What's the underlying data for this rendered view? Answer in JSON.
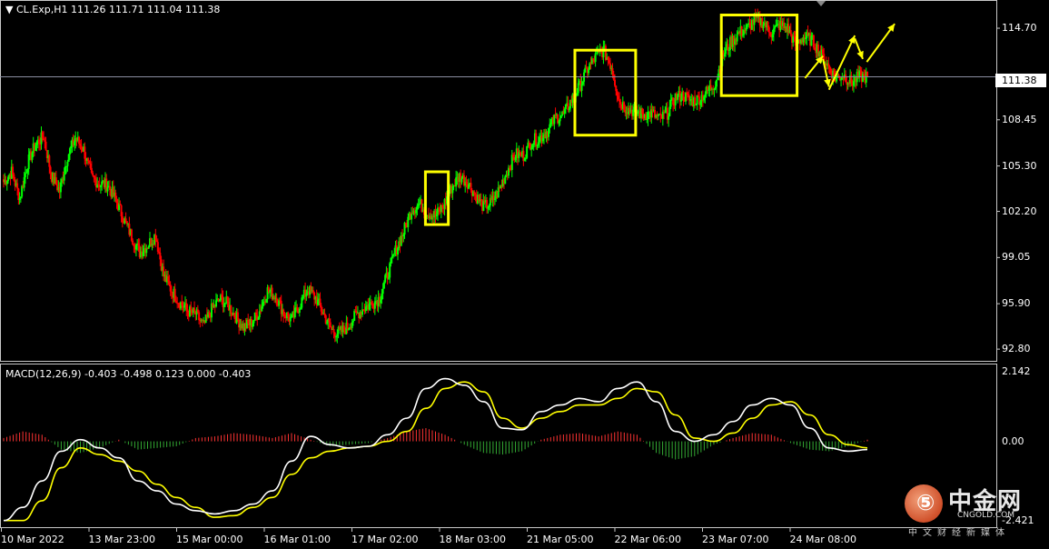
{
  "price_header": "CL.Exp,H1  111.26 111.71 111.04 111.38",
  "macd_header": "MACD(12,26,9) -0.403 -0.498 0.123 0.000 -0.403",
  "current_price": "111.38",
  "colors": {
    "background": "#000000",
    "bull_candle": "#00ff00",
    "bear_candle": "#ff0000",
    "macd_line": "#ffffff",
    "signal_line": "#ffff00",
    "hist_positive": "#ff3333",
    "hist_negative": "#33aa33",
    "annotation_box": "#ffff00",
    "current_price_line": "#8a8ea0"
  },
  "watermark": {
    "logo_glyph": "⑤",
    "text": "中金网",
    "sub": "CNGOLD.COM",
    "sub_cn": "中文财经新媒体"
  },
  "chart_data": [
    {
      "type": "candlestick",
      "title": "CL.Exp,H1",
      "y_ticks": [
        "114.70",
        "111.38",
        "108.45",
        "105.30",
        "102.20",
        "99.05",
        "95.90",
        "92.80"
      ],
      "x_ticks": [
        "10 Mar 2022",
        "13 Mar 23:00",
        "15 Mar 00:00",
        "16 Mar 01:00",
        "17 Mar 02:00",
        "18 Mar 03:00",
        "21 Mar 05:00",
        "22 Mar 06:00",
        "23 Mar 07:00",
        "24 Mar 08:00"
      ],
      "ylim": [
        92.0,
        116.5
      ],
      "close_path": [
        104.2,
        104.9,
        103.1,
        105.5,
        106.8,
        107.3,
        104.6,
        103.6,
        106.0,
        107.2,
        106.4,
        104.5,
        104.1,
        104.0,
        103.0,
        101.7,
        100.5,
        99.4,
        99.9,
        100.6,
        97.8,
        96.8,
        96.0,
        95.4,
        95.2,
        94.4,
        95.5,
        96.2,
        95.9,
        95.0,
        94.3,
        94.6,
        95.4,
        96.8,
        96.4,
        95.3,
        94.8,
        95.8,
        96.9,
        96.3,
        95.2,
        94.1,
        93.9,
        94.3,
        95.1,
        95.6,
        95.9,
        96.3,
        97.9,
        99.5,
        100.8,
        102.3,
        102.7,
        102.1,
        101.9,
        102.6,
        103.8,
        104.6,
        104.2,
        103.3,
        102.5,
        102.8,
        103.7,
        105.0,
        106.1,
        106.0,
        107.0,
        107.2,
        107.7,
        108.6,
        108.8,
        109.8,
        110.7,
        111.9,
        112.7,
        113.2,
        112.1,
        109.7,
        109.2,
        109.0,
        108.8,
        108.9,
        108.5,
        108.9,
        110.0,
        110.1,
        109.7,
        109.9,
        110.4,
        111.0,
        112.9,
        113.8,
        114.4,
        114.7,
        115.3,
        115.1,
        114.4,
        114.9,
        114.7,
        113.6,
        114.1,
        113.9,
        113.1,
        112.2,
        111.3,
        111.5,
        111.0,
        111.4,
        111.38
      ],
      "price_line": 111.38,
      "highlight_boxes": [
        {
          "t0": 0.427,
          "t1": 0.45,
          "low": 101.3,
          "high": 104.9
        },
        {
          "t0": 0.577,
          "t1": 0.638,
          "low": 107.4,
          "high": 113.2
        },
        {
          "t0": 0.724,
          "t1": 0.8,
          "low": 110.1,
          "high": 115.6
        }
      ],
      "forecast_arrows": [
        {
          "from": [
            0.808,
            111.3
          ],
          "to": [
            0.826,
            112.8
          ]
        },
        {
          "from": [
            0.826,
            112.6
          ],
          "to": [
            0.832,
            110.7
          ]
        },
        {
          "from": [
            0.832,
            110.5
          ],
          "to": [
            0.858,
            114.2
          ]
        },
        {
          "from": [
            0.858,
            114.0
          ],
          "to": [
            0.866,
            112.6
          ]
        },
        {
          "from": [
            0.87,
            112.4
          ],
          "to": [
            0.898,
            115.0
          ]
        }
      ]
    },
    {
      "type": "line",
      "title": "MACD(12,26,9)",
      "y_ticks": [
        "2.142",
        "0.00",
        "-2.421"
      ],
      "ylim": [
        -2.6,
        2.3
      ],
      "series": [
        {
          "name": "MACD",
          "values": [
            -2.4,
            -2.0,
            -1.2,
            -0.3,
            0.05,
            -0.2,
            -0.5,
            -1.2,
            -1.5,
            -1.9,
            -2.1,
            -2.2,
            -2.1,
            -1.9,
            -1.5,
            -0.6,
            0.15,
            -0.1,
            -0.2,
            -0.15,
            0.2,
            0.7,
            1.6,
            1.9,
            1.7,
            1.2,
            0.4,
            0.35,
            0.9,
            1.1,
            1.3,
            1.2,
            1.6,
            1.8,
            1.2,
            0.3,
            0.0,
            0.2,
            0.6,
            1.1,
            1.3,
            1.1,
            0.4,
            -0.2,
            -0.3,
            -0.25
          ]
        },
        {
          "name": "Signal",
          "values": [
            -2.4,
            -2.4,
            -1.8,
            -0.8,
            -0.2,
            -0.4,
            -0.6,
            -0.9,
            -1.3,
            -1.7,
            -2.0,
            -2.3,
            -2.25,
            -2.0,
            -1.7,
            -1.0,
            -0.5,
            -0.3,
            -0.2,
            -0.15,
            0.0,
            0.3,
            1.0,
            1.6,
            1.8,
            1.5,
            0.7,
            0.4,
            0.7,
            0.9,
            1.1,
            1.1,
            1.3,
            1.6,
            1.5,
            0.8,
            0.1,
            0.0,
            0.25,
            0.7,
            1.1,
            1.2,
            0.8,
            0.2,
            -0.1,
            -0.2
          ]
        },
        {
          "name": "Histogram",
          "values": [
            0.1,
            0.3,
            0.2,
            -0.25,
            -0.35,
            -0.2,
            0.05,
            -0.25,
            -0.2,
            -0.15,
            0.1,
            0.15,
            0.25,
            0.2,
            0.1,
            0.25,
            0.05,
            -0.15,
            -0.1,
            -0.05,
            0.1,
            0.3,
            0.4,
            0.2,
            -0.1,
            -0.35,
            -0.4,
            -0.3,
            0.05,
            0.2,
            0.25,
            0.15,
            0.3,
            0.2,
            -0.35,
            -0.55,
            -0.45,
            -0.1,
            0.1,
            0.25,
            0.2,
            -0.05,
            -0.25,
            -0.3,
            -0.15,
            0.05
          ]
        }
      ]
    }
  ]
}
